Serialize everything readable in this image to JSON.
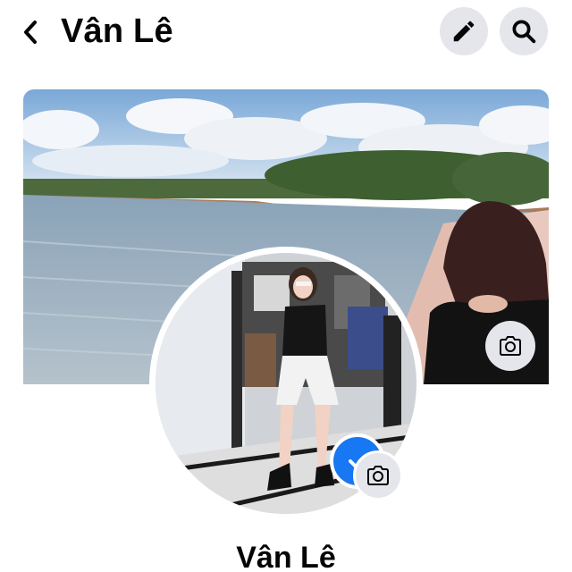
{
  "header": {
    "title": "Vân Lê",
    "back_icon": "chevron-left-icon",
    "edit_icon": "pencil-icon",
    "search_icon": "search-icon"
  },
  "cover": {
    "camera_icon": "camera-icon"
  },
  "avatar": {
    "badge_color": "#1877f2",
    "camera_icon": "camera-icon"
  },
  "profile": {
    "name": "Vân Lê"
  },
  "colors": {
    "button_bg": "#e4e6eb",
    "text": "#050505",
    "accent": "#1877f2"
  }
}
